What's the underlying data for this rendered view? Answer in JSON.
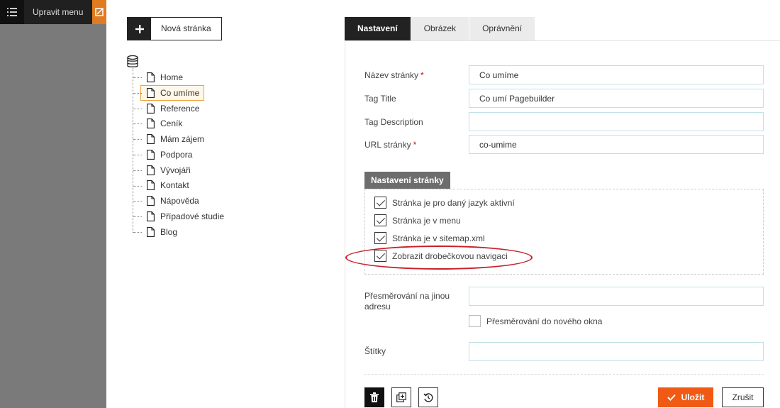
{
  "topbar": {
    "edit_menu_label": "Upravit menu",
    "icons": [
      "list-icon",
      "edit-icon"
    ]
  },
  "new_page_button": {
    "label": "Nová stránka",
    "icon": "plus-icon"
  },
  "tree": {
    "root_icon": "database-icon",
    "items": [
      {
        "label": "Home"
      },
      {
        "label": "Co umíme",
        "selected": true
      },
      {
        "label": "Reference"
      },
      {
        "label": "Ceník"
      },
      {
        "label": "Mám zájem"
      },
      {
        "label": "Podpora"
      },
      {
        "label": "Vývojáři"
      },
      {
        "label": "Kontakt"
      },
      {
        "label": "Nápověda"
      },
      {
        "label": "Případové studie"
      },
      {
        "label": "Blog"
      }
    ]
  },
  "tabs": [
    {
      "label": "Nastavení",
      "active": true
    },
    {
      "label": "Obrázek"
    },
    {
      "label": "Oprávnění"
    }
  ],
  "form": {
    "page_name": {
      "label": "Název stránky",
      "required_mark": "*",
      "value": "Co umíme"
    },
    "tag_title": {
      "label": "Tag Title",
      "value": "Co umí Pagebuilder"
    },
    "tag_description": {
      "label": "Tag Description",
      "value": ""
    },
    "url": {
      "label": "URL stránky",
      "required_mark": "*",
      "value": "co-umime"
    },
    "redirect": {
      "label": "Přesměrování na jinou adresu",
      "value": ""
    },
    "redirect_new_window": {
      "label": "Přesměrování do nového okna",
      "checked": false
    },
    "tags": {
      "label": "Štítky",
      "value": ""
    }
  },
  "page_settings": {
    "title": "Nastavení stránky",
    "options": [
      {
        "label": "Stránka je pro daný jazyk aktivní",
        "checked": true
      },
      {
        "label": "Stránka je v menu",
        "checked": true
      },
      {
        "label": "Stránka je v sitemap.xml",
        "checked": true
      },
      {
        "label": "Zobrazit drobečkovou navigaci",
        "checked": true
      }
    ]
  },
  "footer": {
    "icons": [
      "trash-icon",
      "duplicate-icon",
      "restore-icon"
    ],
    "save_label": "Uložit",
    "cancel_label": "Zrušit"
  },
  "colors": {
    "save": "#f05a14",
    "annotation": "#c8202a",
    "tab_active": "#222222",
    "input_border": "#bfe0e8"
  }
}
